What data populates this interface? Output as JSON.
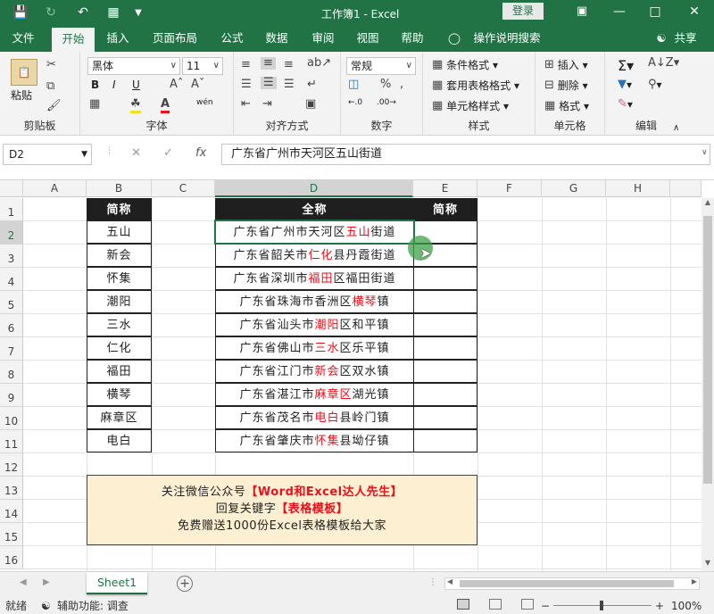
{
  "window": {
    "title": "工作簿1  -  Excel",
    "login_label": "登录",
    "colors": {
      "accent": "#217346",
      "header_bg": "#1f1f1f",
      "highlight_red": "#e8101a",
      "note_bg": "#fcefd2"
    }
  },
  "ribbon_tabs": [
    "文件",
    "开始",
    "插入",
    "页面布局",
    "公式",
    "数据",
    "审阅",
    "视图",
    "帮助"
  ],
  "tell_me": "操作说明搜索",
  "share_label": "共享",
  "ribbon": {
    "clipboard": {
      "paste_label": "粘贴",
      "group_label": "剪贴板"
    },
    "font": {
      "font_name": "黑体",
      "font_size": "11",
      "group_label": "字体",
      "bold": "B",
      "italic": "I",
      "underline": "U"
    },
    "alignment": {
      "group_label": "对齐方式"
    },
    "number": {
      "format": "常规",
      "group_label": "数字"
    },
    "styles": {
      "conditional": "条件格式",
      "table_format": "套用表格格式",
      "cell_style": "单元格样式",
      "group_label": "样式"
    },
    "cells": {
      "insert": "插入",
      "delete": "删除",
      "format": "格式",
      "group_label": "单元格"
    },
    "editing": {
      "group_label": "编辑"
    }
  },
  "formula_bar": {
    "name_box": "D2",
    "formula": "广东省广州市天河区五山街道"
  },
  "columns": [
    "A",
    "B",
    "C",
    "D",
    "E",
    "F",
    "G",
    "H"
  ],
  "rows": [
    "1",
    "2",
    "3",
    "4",
    "5",
    "6",
    "7",
    "8",
    "9",
    "10",
    "11",
    "12",
    "13",
    "14",
    "15",
    "16"
  ],
  "table_b": {
    "header": "简称",
    "items": [
      "五山",
      "新会",
      "怀集",
      "潮阳",
      "三水",
      "仁化",
      "福田",
      "横琴",
      "麻章区",
      "电白"
    ]
  },
  "table_d": {
    "header_full": "全称",
    "header_short": "简称",
    "rows": [
      {
        "pre": "广东省广州市天河区",
        "hl": "五山",
        "post": "街道"
      },
      {
        "pre": "广东省韶关市",
        "hl": "仁化",
        "post": "县丹霞街道"
      },
      {
        "pre": "广东省深圳市",
        "hl": "福田",
        "post": "区福田街道"
      },
      {
        "pre": "广东省珠海市香洲区",
        "hl": "横琴",
        "post": "镇"
      },
      {
        "pre": "广东省汕头市",
        "hl": "潮阳",
        "post": "区和平镇"
      },
      {
        "pre": "广东省佛山市",
        "hl": "三水",
        "post": "区乐平镇"
      },
      {
        "pre": "广东省江门市",
        "hl": "新会",
        "post": "区双水镇"
      },
      {
        "pre": "广东省湛江市",
        "hl": "麻章区",
        "post": "湖光镇"
      },
      {
        "pre": "广东省茂名市",
        "hl": "电白",
        "post": "县岭门镇"
      },
      {
        "pre": "广东省肇庆市",
        "hl": "怀集",
        "post": "县坳仔镇"
      }
    ]
  },
  "note": {
    "line1_pre": "关注微信公众号",
    "line1_hl": "【Word和Excel达人先生】",
    "line2_pre": "回复关键字",
    "line2_hl": "【表格模板】",
    "line3": "免费赠送1000份Excel表格模板给大家"
  },
  "sheet_tab": "Sheet1",
  "status": {
    "mode": "就绪",
    "accessibility": "辅助功能: 调查",
    "zoom": "100%"
  }
}
